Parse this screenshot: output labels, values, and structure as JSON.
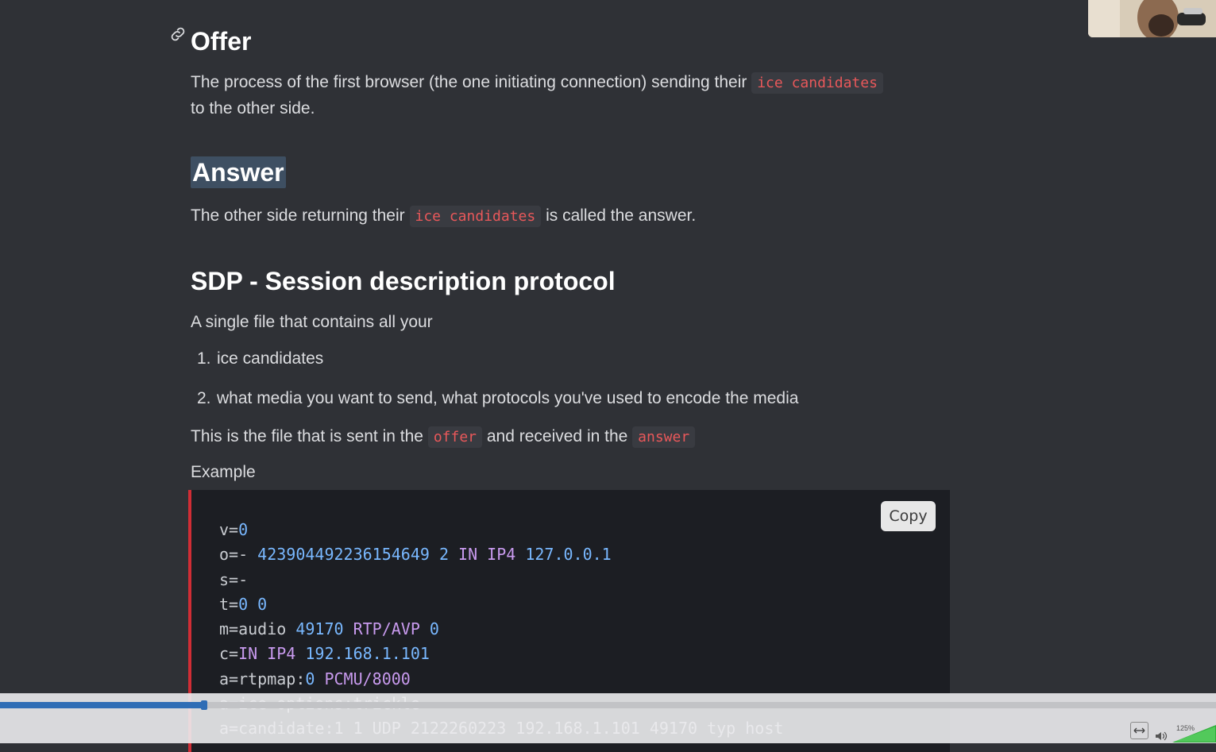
{
  "sections": {
    "offer": {
      "heading": "Offer",
      "text_before": "The process of the first browser (the one initiating connection) sending their",
      "code": "ice candidates",
      "text_after": "to the other side."
    },
    "answer": {
      "heading": "Answer",
      "text_before": "The other side returning their",
      "code": "ice candidates",
      "text_after": "is called the answer."
    },
    "sdp": {
      "heading": "SDP - Session description protocol",
      "intro": "A single file that contains all your",
      "list": [
        {
          "num": "1.",
          "text": "ice candidates"
        },
        {
          "num": "2.",
          "text": "what media you want to send, what protocols you've used to encode the media"
        }
      ],
      "sent_text_1": "This is the file that is sent in the",
      "sent_code_1": "offer",
      "sent_text_2": "and received in the",
      "sent_code_2": "answer",
      "example_label": "Example"
    }
  },
  "code_block": {
    "copy_label": "Copy",
    "lines": [
      [
        [
          "txt",
          "v="
        ],
        [
          "num",
          "0"
        ]
      ],
      [
        [
          "txt",
          "o=- "
        ],
        [
          "num",
          "4239044922361546"
        ],
        [
          "num",
          "49 2 "
        ],
        [
          "kw",
          "IN IP4 "
        ],
        [
          "num",
          "127.0.0.1"
        ]
      ],
      [
        [
          "txt",
          "s=-"
        ]
      ],
      [
        [
          "txt",
          "t="
        ],
        [
          "num",
          "0 0"
        ]
      ],
      [
        [
          "txt",
          "m=audio "
        ],
        [
          "num",
          "49170 "
        ],
        [
          "kw",
          "RTP/AVP "
        ],
        [
          "num",
          "0"
        ]
      ],
      [
        [
          "txt",
          "c="
        ],
        [
          "kw",
          "IN IP4 "
        ],
        [
          "num",
          "192.168.1.101"
        ]
      ],
      [
        [
          "txt",
          "a=rtpmap:"
        ],
        [
          "num",
          "0 "
        ],
        [
          "kw",
          "PCMU/8000"
        ]
      ],
      [
        [
          "txt",
          "a=ice-options:trickle"
        ]
      ],
      [
        [
          "txt",
          "a=candidate:1 1 UDP 2122260223 192.168.1.101 49170 typ host"
        ]
      ]
    ]
  },
  "player": {
    "progress": 0.17,
    "volume_label": "125%"
  },
  "colors": {
    "background": "#2f3136",
    "inline_code": "#e9585a",
    "code_accent": "#d02d35",
    "seek_fill": "#2f6db5"
  }
}
